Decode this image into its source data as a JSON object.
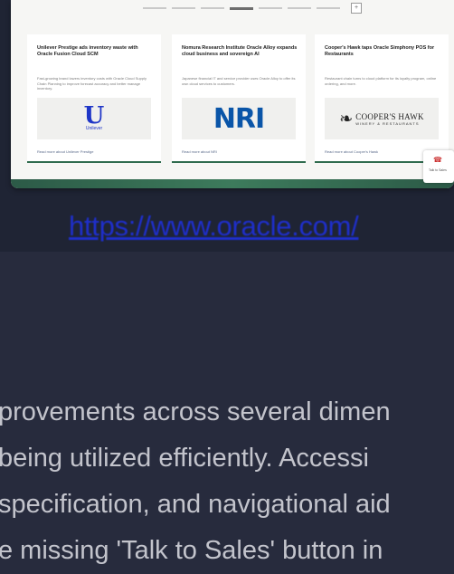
{
  "screenshot": {
    "carousel_nav_icon": "square-nav-icon",
    "cards": [
      {
        "title": "Unilever Prestige ads inventory waste with Oracle Fusion Cloud SCM",
        "body": "Fast-growing brand lowers inventory costs with Oracle Cloud Supply Chain Planning to improve forecast accuracy and better manage inventory.",
        "logo_text": "U",
        "logo_sub": "Unilever",
        "link": "Read more about Unilever Prestige"
      },
      {
        "title": "Nomura Research Institute Oracle Alloy expands cloud business and sovereign AI",
        "body": "Japanese financial IT and service provider uses Oracle Alloy to offer its own cloud services to customers.",
        "logo_text": "NRI",
        "link": "Read more about NRI"
      },
      {
        "title": "Cooper's Hawk taps Oracle Simphony POS for Restaurants",
        "body": "Restaurant chain turns to cloud platform for its loyalty program, online ordering, and more.",
        "logo_text": "COOPER'S HAWK",
        "logo_sub": "WINERY & RESTAURANTS",
        "link": "Read more about Cooper's Hawk"
      }
    ],
    "widget_label": "Talk to Sales"
  },
  "url_link": "https://www.oracle.com/",
  "paragraph": [
    "provements across several dimen",
    " being utilized efficiently. Accessi",
    "specification, and navigational aid",
    "e missing 'Talk to Sales' button in"
  ],
  "colors": {
    "background": "#272b3d",
    "link": "#1f2fcc",
    "text": "#c3c4cc"
  }
}
